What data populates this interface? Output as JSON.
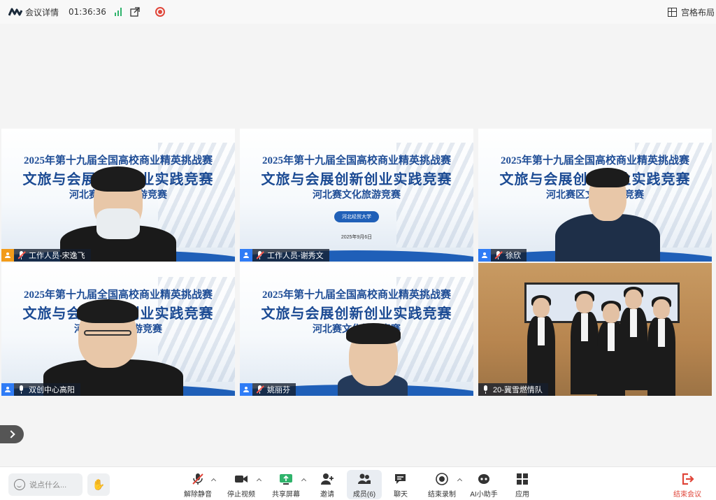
{
  "topbar": {
    "meeting_info_label": "会议详情",
    "timer": "01:36:36",
    "layout_label": "宫格布局"
  },
  "slide": {
    "title_line1": "2025年第十九届全国高校商业精英挑战赛",
    "title_line2": "文旅与会展创新创业实践竞赛",
    "subtitle_a": "河北赛区文化旅游竞赛",
    "subtitle_b": "河北赛文化旅游竞赛",
    "university_badge": "河北经贸大学",
    "date": "2025年9月6日"
  },
  "participants": [
    {
      "name": "工作人员-宋逸飞",
      "role_color": "orange",
      "mic": "on"
    },
    {
      "name": "工作人员-谢秀文",
      "role_color": "blue",
      "mic": "on"
    },
    {
      "name": "徐欣",
      "role_color": "blue",
      "mic": "on"
    },
    {
      "name": "双创中心高阳",
      "role_color": "blue",
      "mic": "on"
    },
    {
      "name": "姚丽芬",
      "role_color": "blue",
      "mic": "on"
    },
    {
      "name": "20-冀雪燃情队",
      "role_color": "green",
      "mic": "on",
      "speaking": true
    }
  ],
  "toolbar": {
    "chat_placeholder": "说点什么...",
    "unmute": "解除静音",
    "stop_video": "停止视频",
    "share_screen": "共享屏幕",
    "invite": "邀请",
    "members": "成员(6)",
    "chat": "聊天",
    "end_recording": "结束录制",
    "ai_assistant": "AI小助手",
    "apps": "应用",
    "end_meeting": "结束会议"
  },
  "colors": {
    "accent_blue": "#2f7cf6",
    "end_red": "#e0463a",
    "speaking_border": "#5fd39a",
    "signal_green": "#2fb36b"
  }
}
